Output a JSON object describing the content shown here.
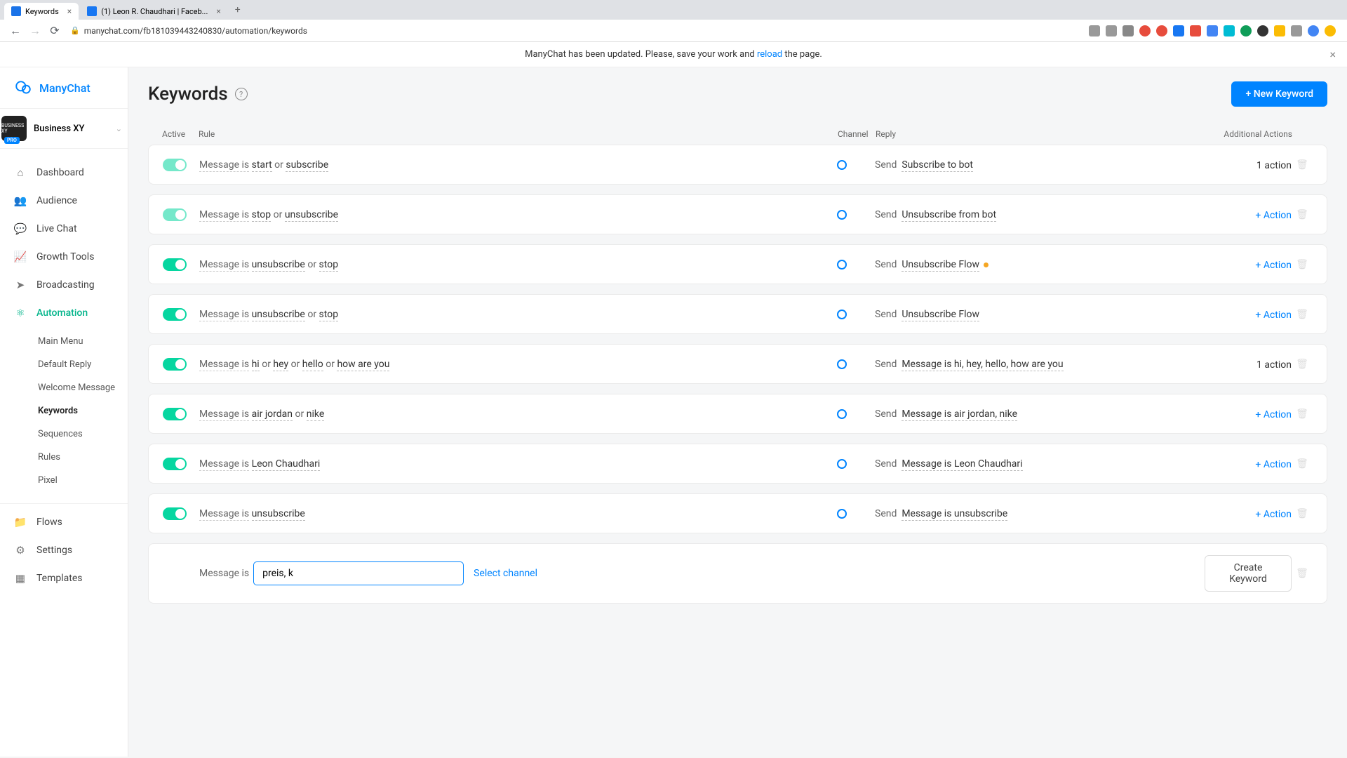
{
  "browser": {
    "tabs": [
      {
        "title": "Keywords",
        "favicon": "mc"
      },
      {
        "title": "(1) Leon R. Chaudhari | Faceb...",
        "favicon": "fb"
      }
    ],
    "url": "manychat.com/fb181039443240830/automation/keywords"
  },
  "banner": {
    "text_before": "ManyChat has been updated. Please, save your work and ",
    "link": "reload",
    "text_after": " the page."
  },
  "brand": "ManyChat",
  "workspace": {
    "name": "Business XY",
    "badge": "PRO"
  },
  "nav": {
    "dashboard": "Dashboard",
    "audience": "Audience",
    "live_chat": "Live Chat",
    "growth_tools": "Growth Tools",
    "broadcasting": "Broadcasting",
    "automation": "Automation",
    "flows": "Flows",
    "settings": "Settings",
    "templates": "Templates"
  },
  "subnav": {
    "main_menu": "Main Menu",
    "default_reply": "Default Reply",
    "welcome_message": "Welcome Message",
    "keywords": "Keywords",
    "sequences": "Sequences",
    "rules": "Rules",
    "pixel": "Pixel"
  },
  "page": {
    "title": "Keywords",
    "new_button": "+ New Keyword",
    "create_button": "Create Keyword",
    "select_channel": "Select channel"
  },
  "columns": {
    "active": "Active",
    "rule": "Rule",
    "channel": "Channel",
    "reply": "Reply",
    "actions": "Additional Actions"
  },
  "labels": {
    "message_is": "Message is",
    "or": "or",
    "send": "Send",
    "add_action": "+ Action",
    "one_action": "1 action"
  },
  "rules": [
    {
      "faded": true,
      "keywords": [
        "start",
        "subscribe"
      ],
      "reply": "Subscribe to bot",
      "actions": "count",
      "status": null
    },
    {
      "faded": true,
      "keywords": [
        "stop",
        "unsubscribe"
      ],
      "reply": "Unsubscribe from bot",
      "actions": "add",
      "status": null
    },
    {
      "faded": false,
      "keywords": [
        "unsubscribe",
        "stop"
      ],
      "reply": "Unsubscribe Flow",
      "actions": "add",
      "status": "warn"
    },
    {
      "faded": false,
      "keywords": [
        "unsubscribe",
        "stop"
      ],
      "reply": "Unsubscribe Flow",
      "actions": "add",
      "status": null
    },
    {
      "faded": false,
      "keywords": [
        "hi",
        "hey",
        "hello",
        "how are you"
      ],
      "reply": "Message is hi, hey, hello, how are you",
      "actions": "count",
      "status": null
    },
    {
      "faded": false,
      "keywords": [
        "air jordan",
        "nike"
      ],
      "reply": "Message is air jordan, nike",
      "actions": "add",
      "status": null
    },
    {
      "faded": false,
      "keywords": [
        "Leon Chaudhari"
      ],
      "reply": "Message is Leon Chaudhari",
      "actions": "add",
      "status": null
    },
    {
      "faded": false,
      "keywords": [
        "unsubscribe"
      ],
      "reply": "Message is unsubscribe",
      "actions": "add",
      "status": null
    }
  ],
  "new_rule": {
    "input_value": "preis, k"
  }
}
